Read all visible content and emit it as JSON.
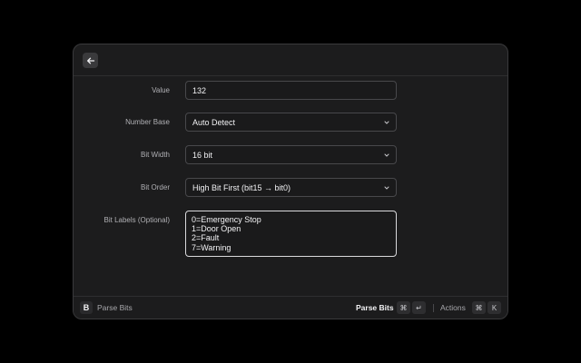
{
  "form": {
    "value": {
      "label": "Value",
      "input": "132"
    },
    "number_base": {
      "label": "Number Base",
      "selected": "Auto Detect"
    },
    "bit_width": {
      "label": "Bit Width",
      "selected": "16 bit"
    },
    "bit_order": {
      "label": "Bit Order",
      "selected": "High Bit First (bit15 → bit0)"
    },
    "bit_labels": {
      "label": "Bit Labels (Optional)",
      "text": "0=Emergency Stop\n1=Door Open\n2=Fault\n7=Warning"
    }
  },
  "footer": {
    "app_icon": "B",
    "title": "Parse Bits",
    "primary_action": "Parse Bits",
    "primary_keys": [
      "⌘",
      "↵"
    ],
    "actions_label": "Actions",
    "actions_keys": [
      "⌘",
      "K"
    ]
  },
  "icons": {
    "back": "arrow-left-icon",
    "dropdown": "chevron-down-icon"
  },
  "colors": {
    "background": "#000000",
    "panel": "#1c1c1d",
    "input_border": "#48484b",
    "focused_border": "#d9d9dc",
    "text": "#f2f2f4",
    "label": "#b0b0b4"
  }
}
